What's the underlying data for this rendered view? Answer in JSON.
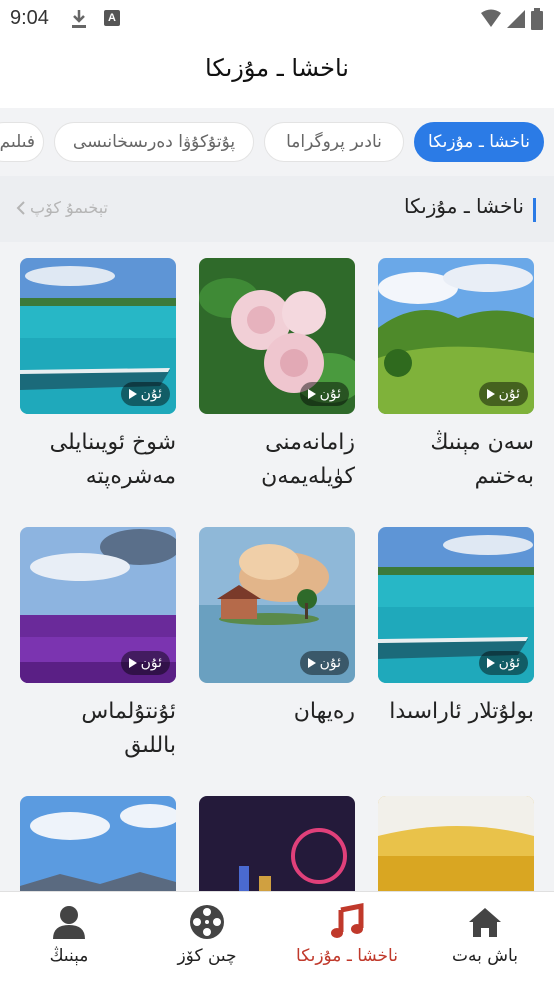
{
  "status_bar": {
    "time": "9:04",
    "notif_letter": "A"
  },
  "header": {
    "title": "ناخشا ـ مۇزىكا"
  },
  "tabs": [
    {
      "label": "ناخشا ـ مۇزىكا",
      "active": true
    },
    {
      "label": "نادىر پروگراما",
      "active": false
    },
    {
      "label": "پۇتۇكۇۋا دەرىسخانىسى",
      "active": false
    },
    {
      "label": "فىلىم",
      "active": false
    }
  ],
  "section": {
    "title": "ناخشا ـ مۇزىكا",
    "more": "تېخىمۇ كۆپ"
  },
  "cards": [
    {
      "title_line1": "سەن مېنىڭ",
      "title_line2": "بەختىم",
      "badge": "ئۇن"
    },
    {
      "title_line1": "زامانەمنى",
      "title_line2": "كۈيلەيمەن",
      "badge": "ئۇن"
    },
    {
      "title_line1": "شوخ ئويىنايلى",
      "title_line2": "مەشرەپتە",
      "badge": "ئۇن"
    },
    {
      "title_line1": "بولۇتلار ئاراسىدا",
      "title_line2": "",
      "badge": "ئۇن"
    },
    {
      "title_line1": "رەيھان",
      "title_line2": "",
      "badge": "ئۇن"
    },
    {
      "title_line1": "ئۇنتۇلماس",
      "title_line2": "باللىق",
      "badge": "ئۇن"
    },
    {
      "title_line1": "",
      "title_line2": "",
      "badge": ""
    },
    {
      "title_line1": "",
      "title_line2": "",
      "badge": ""
    },
    {
      "title_line1": "",
      "title_line2": "",
      "badge": ""
    }
  ],
  "bottom_nav": [
    {
      "label": "باش بەت",
      "icon": "home-icon",
      "active": false
    },
    {
      "label": "ناخشا ـ مۇزىكا",
      "icon": "music-note-icon",
      "active": true
    },
    {
      "label": "چىن كۆز",
      "icon": "film-reel-icon",
      "active": false
    },
    {
      "label": "مېنىڭ",
      "icon": "user-icon",
      "active": false
    }
  ],
  "colors": {
    "accent": "#2b7be6",
    "active_nav": "#c0392b"
  }
}
